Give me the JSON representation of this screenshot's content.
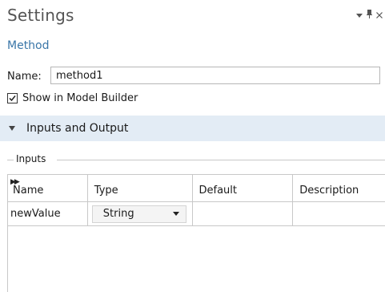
{
  "header": {
    "title": "Settings",
    "subtitle": "Method",
    "controls": {
      "menu_icon": "chevron-down-icon",
      "pin_icon": "pin-icon",
      "close_icon": "close-icon"
    }
  },
  "form": {
    "name_label": "Name:",
    "name_value": "method1",
    "show_in_model_builder_label": "Show in Model Builder",
    "show_in_model_builder_checked": true
  },
  "section": {
    "title": "Inputs and Output",
    "expanded": true,
    "background": "#e3ecf5"
  },
  "inputs_group": {
    "label": "Inputs",
    "table": {
      "columns": [
        "Name",
        "Type",
        "Default",
        "Description"
      ],
      "rows": [
        {
          "name": "newValue",
          "type": "String",
          "default": "",
          "description": ""
        }
      ]
    }
  },
  "colors": {
    "title_text": "#555555",
    "subtitle_text": "#3a76a8",
    "border": "#c8c8c8"
  }
}
